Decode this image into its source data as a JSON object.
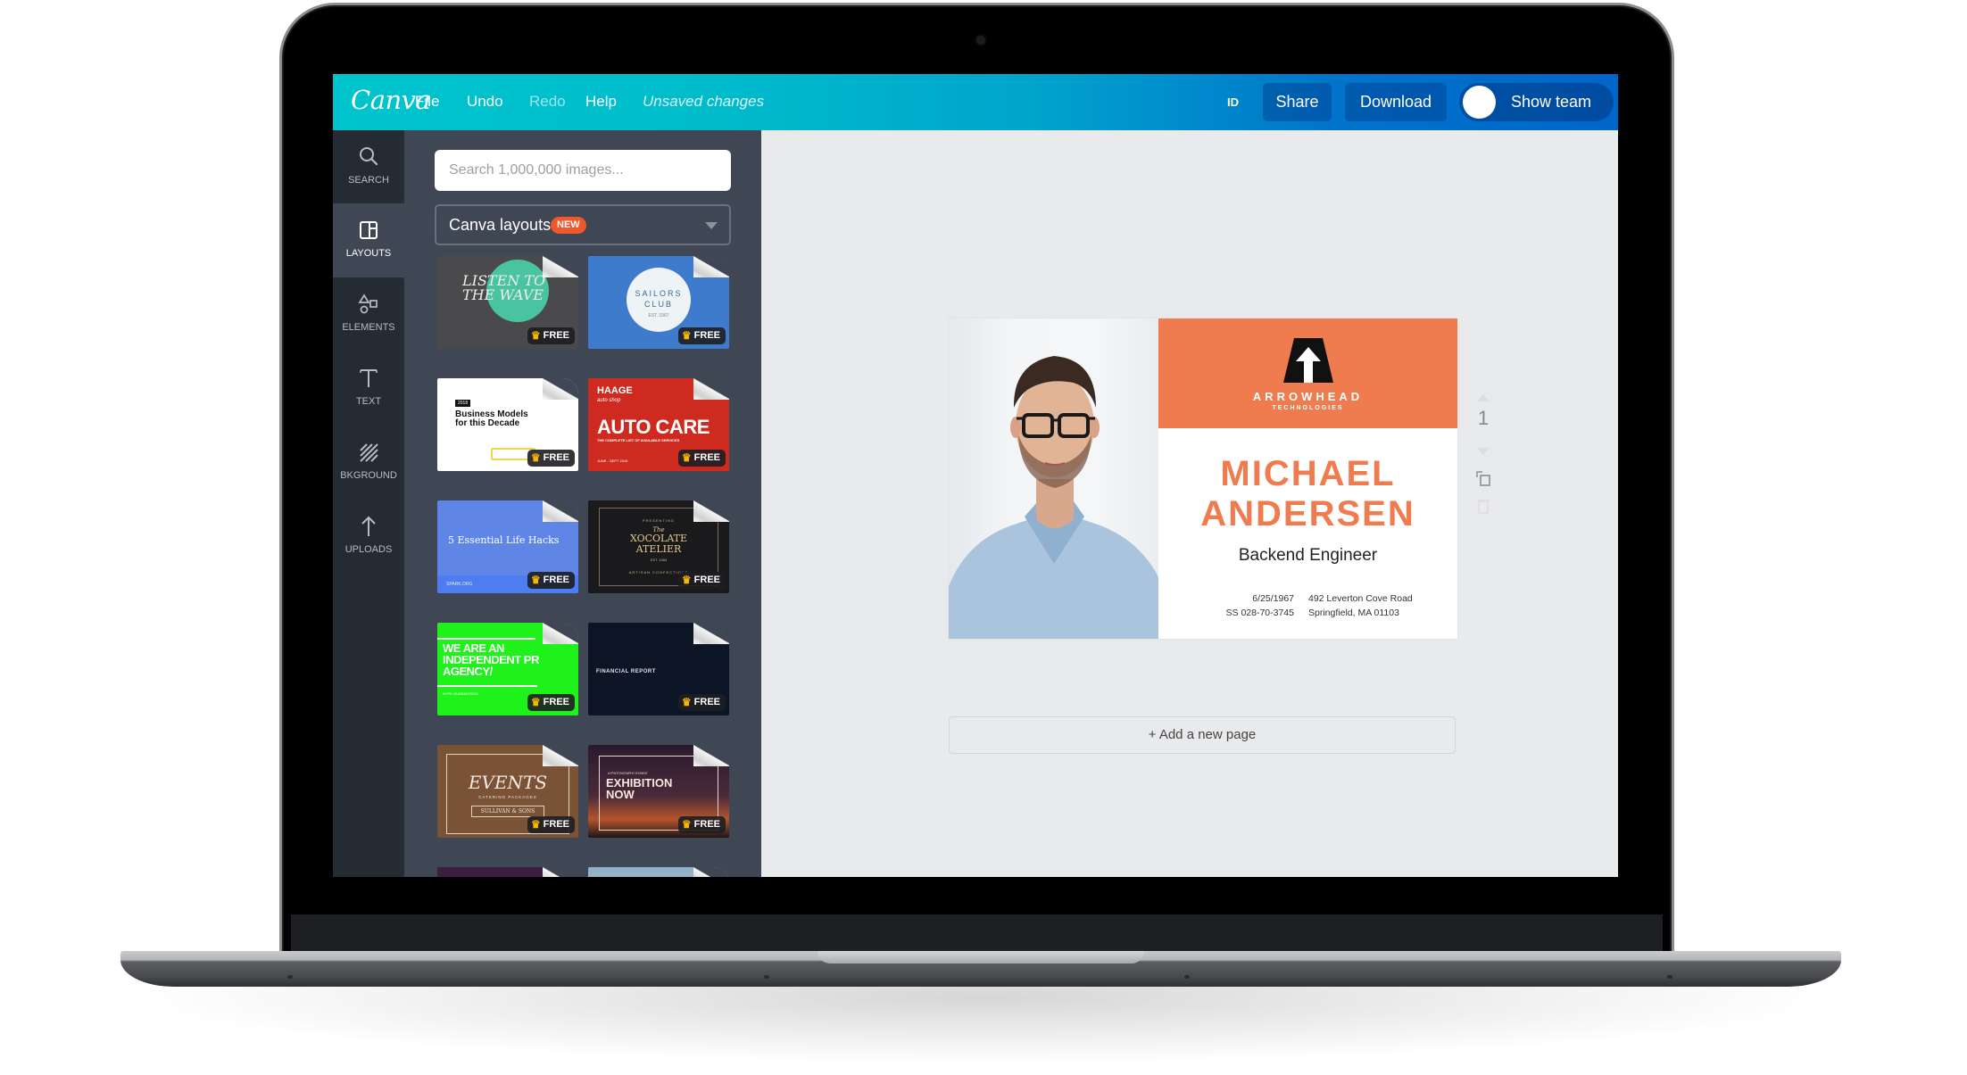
{
  "app": {
    "logo": "Canva",
    "menu": [
      {
        "label": "File",
        "state": "enabled"
      },
      {
        "label": "Undo",
        "state": "enabled"
      },
      {
        "label": "Redo",
        "state": "disabled"
      },
      {
        "label": "Help",
        "state": "enabled"
      }
    ],
    "status": "Unsaved changes",
    "id_label": "ID",
    "share_label": "Share",
    "download_label": "Download",
    "show_team_label": "Show team",
    "colors": {
      "header_start": "#00c4cc",
      "header_end": "#0065c8",
      "sidebar": "#252b33",
      "panel": "#3f4654",
      "canvas_bg": "#e9eaec",
      "accent_orange": "#f07b4f",
      "new_badge": "#f0572a",
      "free_crown": "#f7b800"
    }
  },
  "sidebar": {
    "items": [
      {
        "label": "SEARCH",
        "icon": "search-icon",
        "active": false
      },
      {
        "label": "LAYOUTS",
        "icon": "layouts-icon",
        "active": true
      },
      {
        "label": "ELEMENTS",
        "icon": "shapes-icon",
        "active": false
      },
      {
        "label": "TEXT",
        "icon": "text-icon",
        "active": false
      },
      {
        "label": "BKGROUND",
        "icon": "background-stripes-icon",
        "active": false
      },
      {
        "label": "UPLOADS",
        "icon": "upload-arrow-icon",
        "active": false
      }
    ]
  },
  "panel": {
    "search_placeholder": "Search 1,000,000 images...",
    "dropdown_value": "Canva layouts",
    "dropdown_badge": "NEW",
    "free_label": "FREE",
    "templates": [
      {
        "title": "LISTEN TO THE WAVE",
        "free": true
      },
      {
        "title": "SAILORS CLUB",
        "subtitle": "EST. 1967",
        "free": true
      },
      {
        "title": "Business Models for this Decade",
        "tag": "2018",
        "free": true
      },
      {
        "title": "AUTO CARE",
        "brand": "HAAGE",
        "brand_sub": "auto shop",
        "subtitle": "THE COMPLETE LIST OF AVAILABLE SERVICES",
        "footer": "JUNE - SEPT 2015",
        "free": true
      },
      {
        "title": "5 Essential Life Hacks",
        "footer": "SPARK.ORG",
        "free": true
      },
      {
        "title": "XOCOLATE ATELIER",
        "pre": "PRESENTING",
        "article": "The",
        "subtitle": "EST. 1984",
        "footer": "ARTISAN CONFECTIONS",
        "free": true
      },
      {
        "title": "WE ARE AN INDEPENDENT PR AGENCY/",
        "footer": "HYPE GUARANTEED",
        "free": true
      },
      {
        "title": "FINANCIAL REPORT",
        "free": true
      },
      {
        "title": "EVENTS",
        "subtitle": "CATERING PACKAGES",
        "footer": "SULLIVAN & SONS",
        "free": true
      },
      {
        "title": "EXHIBITION NOW",
        "pre": "A PHOTOGRAPHY EXHIBIT",
        "free": true
      },
      {
        "title": "",
        "free": false
      },
      {
        "title": "",
        "free": false
      }
    ]
  },
  "design": {
    "company": "ARROWHEAD",
    "company_sub": "TECHNOLOGIES",
    "first_name": "MICHAEL",
    "last_name": "ANDERSEN",
    "role": "Backend Engineer",
    "dob": "6/25/1967",
    "ss": "SS 028-70-3745",
    "address_line1": "492 Leverton Cove Road",
    "address_line2": "Springfield, MA 01103",
    "page_number": "1"
  },
  "canvas": {
    "add_page_label": "+ Add a new page"
  }
}
